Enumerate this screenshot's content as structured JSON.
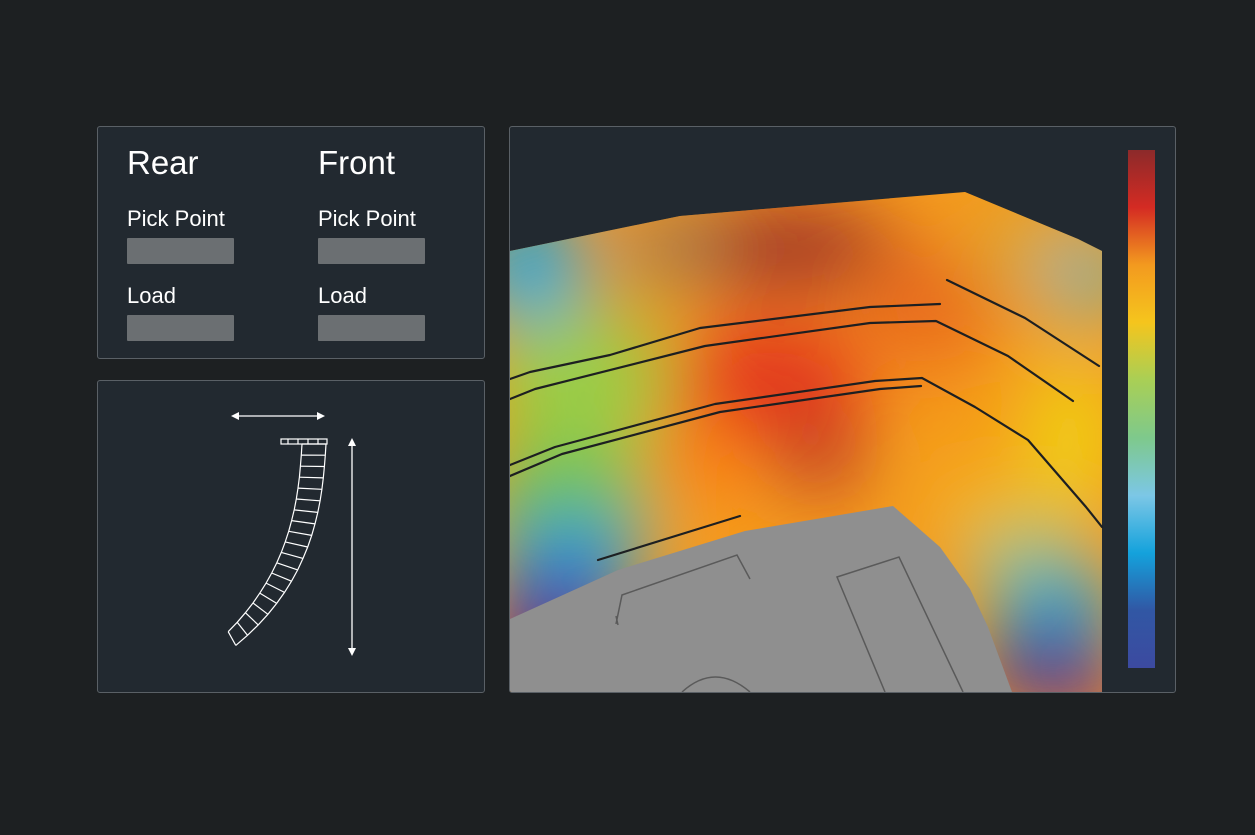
{
  "rigging": {
    "rear": {
      "heading": "Rear",
      "pick_point_label": "Pick Point",
      "pick_point_value": "",
      "load_label": "Load",
      "load_value": ""
    },
    "front": {
      "heading": "Front",
      "pick_point_label": "Pick Point",
      "pick_point_value": "",
      "load_label": "Load",
      "load_value": ""
    }
  },
  "array_view": {
    "icons": [
      "width-dimension-arrow-icon",
      "height-dimension-arrow-icon",
      "line-array-icon"
    ],
    "line_color": "#ffffff"
  },
  "coverage_map": {
    "colorbar_stops": [
      "#8c2a2a",
      "#d42b23",
      "#f39a1f",
      "#f5c51d",
      "#a9cf55",
      "#7ec98c",
      "#7cc7e6",
      "#14a2dc",
      "#3157a4",
      "#3c4aa0"
    ],
    "venue_color": "#8f8f8f",
    "background": "#222930"
  }
}
